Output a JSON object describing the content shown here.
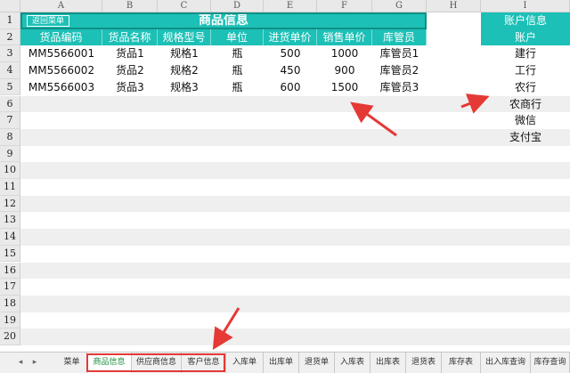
{
  "column_headers": [
    "A",
    "B",
    "C",
    "D",
    "E",
    "F",
    "G",
    "H",
    "I"
  ],
  "row_numbers": [
    "1",
    "2",
    "3",
    "4",
    "5",
    "6",
    "7",
    "8",
    "9",
    "10",
    "11",
    "12",
    "13",
    "14",
    "15",
    "16",
    "17",
    "18",
    "19",
    "20"
  ],
  "back_button_label": "返回菜单",
  "title": "商品信息",
  "table": {
    "headers": [
      "货品编码",
      "货品名称",
      "规格型号",
      "单位",
      "进货单价",
      "销售单价",
      "库管员"
    ],
    "rows": [
      [
        "MM5566001",
        "货品1",
        "规格1",
        "瓶",
        "500",
        "1000",
        "库管员1"
      ],
      [
        "MM5566002",
        "货品2",
        "规格2",
        "瓶",
        "450",
        "900",
        "库管员2"
      ],
      [
        "MM5566003",
        "货品3",
        "规格3",
        "瓶",
        "600",
        "1500",
        "库管员3"
      ]
    ]
  },
  "accounts": {
    "title": "账户信息",
    "header": "账户",
    "items": [
      "建行",
      "工行",
      "农行",
      "农商行",
      "微信",
      "支付宝"
    ]
  },
  "sheet_tabs": [
    "菜单",
    "商品信息",
    "供应商信息",
    "客户信息",
    "入库单",
    "出库单",
    "退货单",
    "入库表",
    "出库表",
    "退货表",
    "库存表",
    "出入库查询",
    "库存查询"
  ],
  "active_tab": "商品信息",
  "colors": {
    "header_teal": "#1cc0b6",
    "title_border": "#0f8f86",
    "annotation_red": "#e53935",
    "active_tab_text": "#1a8f3c"
  },
  "icons": [
    "scroll-left-icon",
    "scroll-right-icon",
    "red-arrow-annotation"
  ]
}
